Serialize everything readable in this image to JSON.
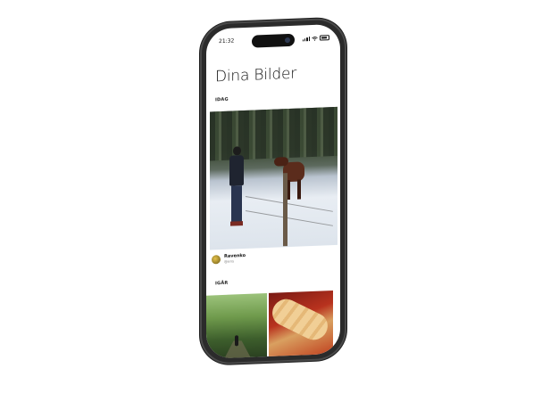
{
  "status_bar": {
    "time": "21:32"
  },
  "page": {
    "title": "Dina Bilder"
  },
  "sections": [
    {
      "label": "IDAG",
      "post": {
        "uploader_name": "Ravenko",
        "uploader_handle": "@ens"
      }
    },
    {
      "label": "IGÅR"
    }
  ],
  "icons": [
    "signal-icon",
    "wifi-icon",
    "battery-icon",
    "camera-icon"
  ]
}
